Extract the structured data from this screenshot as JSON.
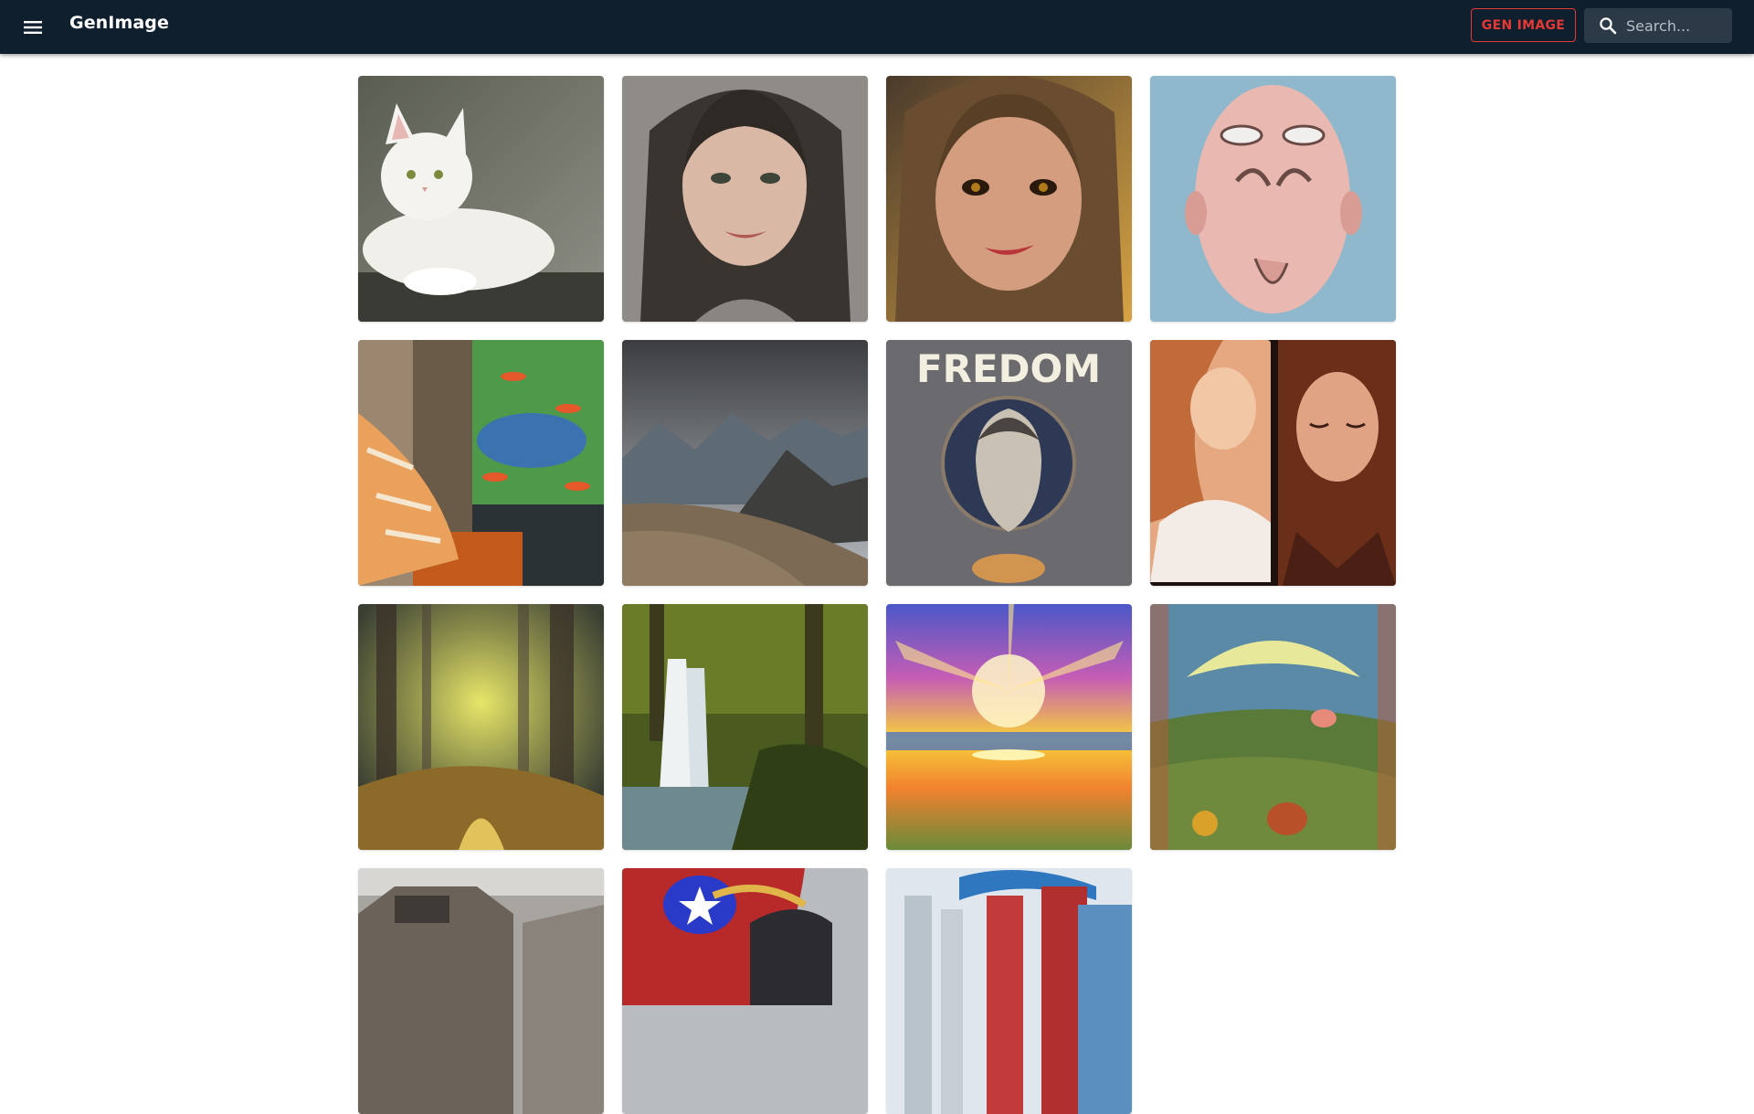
{
  "app": {
    "title": "GenImage",
    "gen_button_label": "GEN IMAGE",
    "search": {
      "placeholder": "Search..."
    },
    "colors": {
      "appbar": "#0f1f2e",
      "accent": "#e53935",
      "search_bg": "#2c3a48"
    }
  },
  "icons": {
    "menu": "menu-icon",
    "search": "search-icon"
  },
  "gallery": {
    "images": [
      {
        "subject": "white-cat"
      },
      {
        "subject": "woman-portrait-dark-hair"
      },
      {
        "subject": "girl-portrait-painted"
      },
      {
        "subject": "distorted-face"
      },
      {
        "subject": "cat-at-window-koi"
      },
      {
        "subject": "mountain-landscape"
      },
      {
        "subject": "freedom-poster"
      },
      {
        "subject": "two-women-faces"
      },
      {
        "subject": "misty-forest"
      },
      {
        "subject": "waterfall-forest"
      },
      {
        "subject": "sunset-rainbow"
      },
      {
        "subject": "surreal-landscape"
      },
      {
        "subject": "building-grey"
      },
      {
        "subject": "superhero-helmet"
      },
      {
        "subject": "city-towers"
      }
    ],
    "poster_text": "FREDOM"
  }
}
